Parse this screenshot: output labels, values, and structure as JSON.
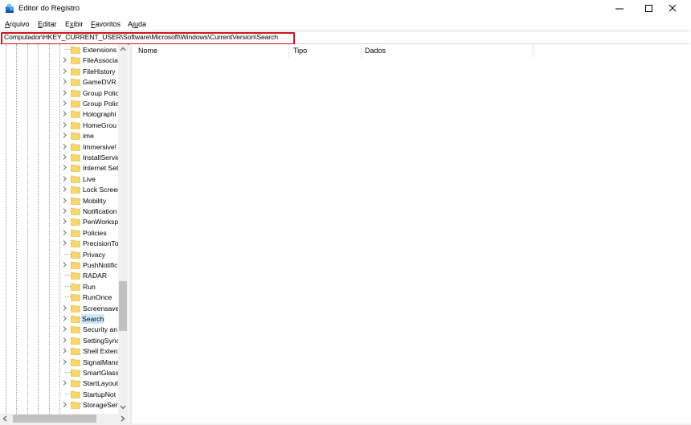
{
  "window": {
    "title": "Editor do Registro",
    "icon": "registry-editor-icon"
  },
  "menu": [
    {
      "label": "Arquivo",
      "accel": "A",
      "rest": "rquivo"
    },
    {
      "label": "Editar",
      "accel": "E",
      "rest": "ditar"
    },
    {
      "label": "Exibir",
      "accel": "x",
      "pre": "E",
      "rest": "ibir"
    },
    {
      "label": "Favoritos",
      "accel": "F",
      "rest": "avoritos"
    },
    {
      "label": "Ajuda",
      "accel": "u",
      "pre": "Aj",
      "rest": "da"
    }
  ],
  "address": {
    "path": "Computador\\HKEY_CURRENT_USER\\Software\\Microsoft\\Windows\\CurrentVersion\\Search",
    "highlight_color": "#d0141f"
  },
  "tree": {
    "items": [
      {
        "label": "Extensions",
        "expandable": false
      },
      {
        "label": "FileAssocia",
        "expandable": true
      },
      {
        "label": "FileHistory",
        "expandable": true
      },
      {
        "label": "GameDVR",
        "expandable": true
      },
      {
        "label": "Group Polic",
        "expandable": true
      },
      {
        "label": "Group Polic",
        "expandable": true
      },
      {
        "label": "Holographi",
        "expandable": true
      },
      {
        "label": "HomeGrou",
        "expandable": true
      },
      {
        "label": "ime",
        "expandable": true
      },
      {
        "label": "Immersive!",
        "expandable": true
      },
      {
        "label": "InstallServic",
        "expandable": true
      },
      {
        "label": "Internet Set",
        "expandable": true
      },
      {
        "label": "Live",
        "expandable": true
      },
      {
        "label": "Lock Screer",
        "expandable": true
      },
      {
        "label": "Mobility",
        "expandable": true
      },
      {
        "label": "Notification",
        "expandable": true
      },
      {
        "label": "PenWorksp",
        "expandable": true
      },
      {
        "label": "Policies",
        "expandable": true
      },
      {
        "label": "PrecisionTo",
        "expandable": true
      },
      {
        "label": "Privacy",
        "expandable": false
      },
      {
        "label": "PushNotific",
        "expandable": true
      },
      {
        "label": "RADAR",
        "expandable": false
      },
      {
        "label": "Run",
        "expandable": false
      },
      {
        "label": "RunOnce",
        "expandable": false
      },
      {
        "label": "Screensave",
        "expandable": true
      },
      {
        "label": "Search",
        "expandable": true,
        "selected": true
      },
      {
        "label": "Security an",
        "expandable": true
      },
      {
        "label": "SettingSync",
        "expandable": true
      },
      {
        "label": "Shell Exten",
        "expandable": true
      },
      {
        "label": "SignalMana",
        "expandable": true
      },
      {
        "label": "SmartGlass",
        "expandable": false
      },
      {
        "label": "StartLayout",
        "expandable": true
      },
      {
        "label": "StartupNot",
        "expandable": false
      },
      {
        "label": "StorageSen",
        "expandable": true
      }
    ],
    "selection_color": "#cce8ff",
    "folder_color": "#f5d76e"
  },
  "values": {
    "columns": [
      "Nome",
      "Tipo",
      "Dados"
    ]
  }
}
